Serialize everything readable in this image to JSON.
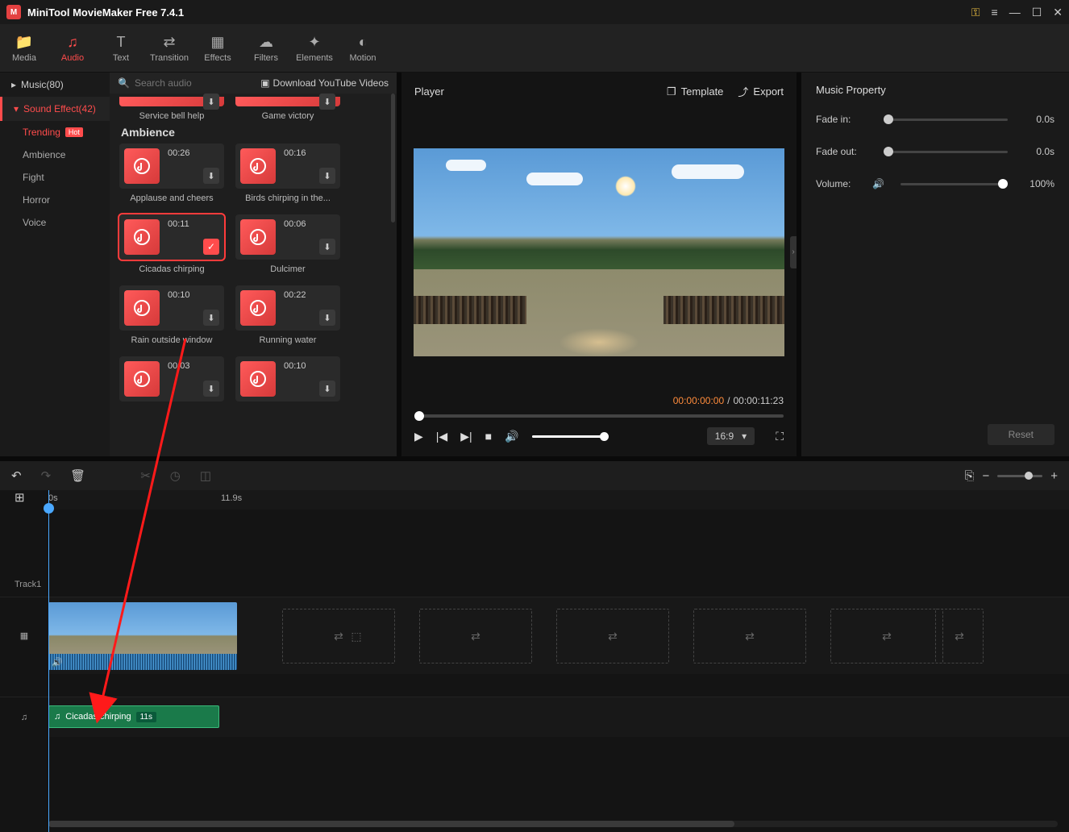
{
  "app": {
    "title": "MiniTool MovieMaker Free 7.4.1"
  },
  "toolbar": [
    {
      "icon": "📁",
      "label": "Media"
    },
    {
      "icon": "♫",
      "label": "Audio"
    },
    {
      "icon": "T",
      "label": "Text"
    },
    {
      "icon": "⇄",
      "label": "Transition"
    },
    {
      "icon": "▦",
      "label": "Effects"
    },
    {
      "icon": "☁",
      "label": "Filters"
    },
    {
      "icon": "✦",
      "label": "Elements"
    },
    {
      "icon": "◐",
      "label": "Motion"
    }
  ],
  "sidebar": {
    "cats": [
      {
        "label": "Music(80)",
        "expand": "▸"
      },
      {
        "label": "Sound Effect(42)",
        "expand": "▾"
      }
    ],
    "subs": [
      {
        "label": "Trending",
        "hot": "Hot"
      },
      {
        "label": "Ambience"
      },
      {
        "label": "Fight"
      },
      {
        "label": "Horror"
      },
      {
        "label": "Voice"
      }
    ]
  },
  "library": {
    "search_placeholder": "Search audio",
    "download_label": "Download YouTube Videos",
    "section": "Ambience",
    "partial": [
      {
        "label": "Service bell help"
      },
      {
        "label": "Game victory"
      }
    ],
    "cards": [
      {
        "dur": "00:26",
        "label": "Applause and cheers"
      },
      {
        "dur": "00:16",
        "label": "Birds chirping in the..."
      },
      {
        "dur": "00:11",
        "label": "Cicadas chirping",
        "selected": true
      },
      {
        "dur": "00:06",
        "label": "Dulcimer"
      },
      {
        "dur": "00:10",
        "label": "Rain outside window"
      },
      {
        "dur": "00:22",
        "label": "Running water"
      },
      {
        "dur": "00:03",
        "label": ""
      },
      {
        "dur": "00:10",
        "label": ""
      }
    ]
  },
  "player": {
    "title": "Player",
    "template": "Template",
    "export": "Export",
    "cur": "00:00:00:00",
    "sep": "/",
    "tot": "00:00:11:23",
    "aspect": "16:9"
  },
  "panel": {
    "title": "Music Property",
    "fade_in": "Fade in:",
    "fade_in_val": "0.0s",
    "fade_out": "Fade out:",
    "fade_out_val": "0.0s",
    "volume": "Volume:",
    "volume_val": "100%",
    "reset": "Reset"
  },
  "timeline": {
    "zero": "0s",
    "mark": "11.9s",
    "track1": "Track1",
    "audio_clip": "Cicadas chirping",
    "audio_dur": "11s"
  }
}
